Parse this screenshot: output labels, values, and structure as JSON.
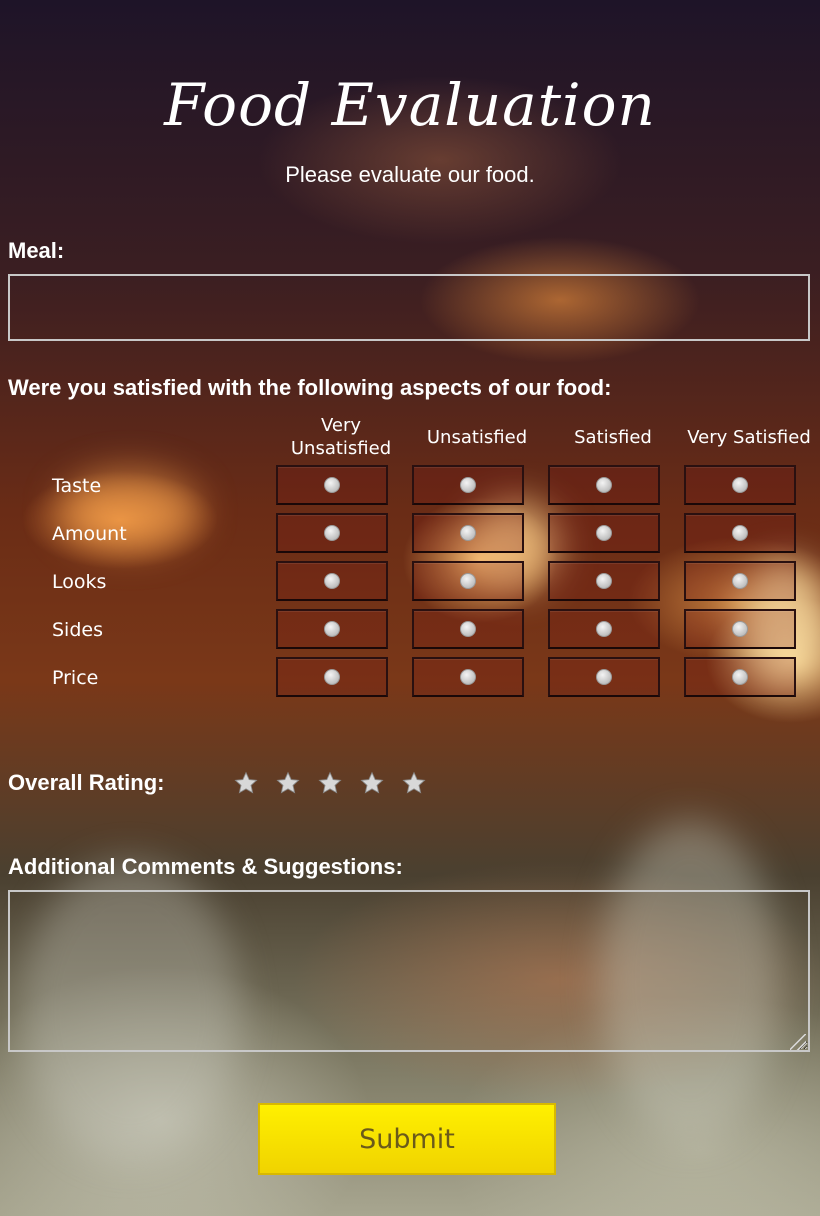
{
  "form": {
    "title": "Food Evaluation",
    "subtitle": "Please evaluate our food."
  },
  "meal": {
    "label": "Meal:",
    "value": "",
    "placeholder": ""
  },
  "satisfaction": {
    "question": "Were you satisfied with the following aspects of our food:",
    "columns": [
      "Very Unsatisfied",
      "Unsatisfied",
      "Satisfied",
      "Very Satisfied"
    ],
    "rows": [
      "Taste",
      "Amount",
      "Looks",
      "Sides",
      "Price"
    ],
    "selected": [
      null,
      null,
      null,
      null,
      null
    ]
  },
  "rating": {
    "label": "Overall Rating:",
    "max_stars": 5,
    "value": 0
  },
  "comments": {
    "label": "Additional Comments & Suggestions:",
    "value": ""
  },
  "submit": {
    "label": "Submit"
  },
  "colors": {
    "submit_bg": "#f5e000",
    "submit_text": "#6b5a1a",
    "border": "#c8c8c8"
  }
}
